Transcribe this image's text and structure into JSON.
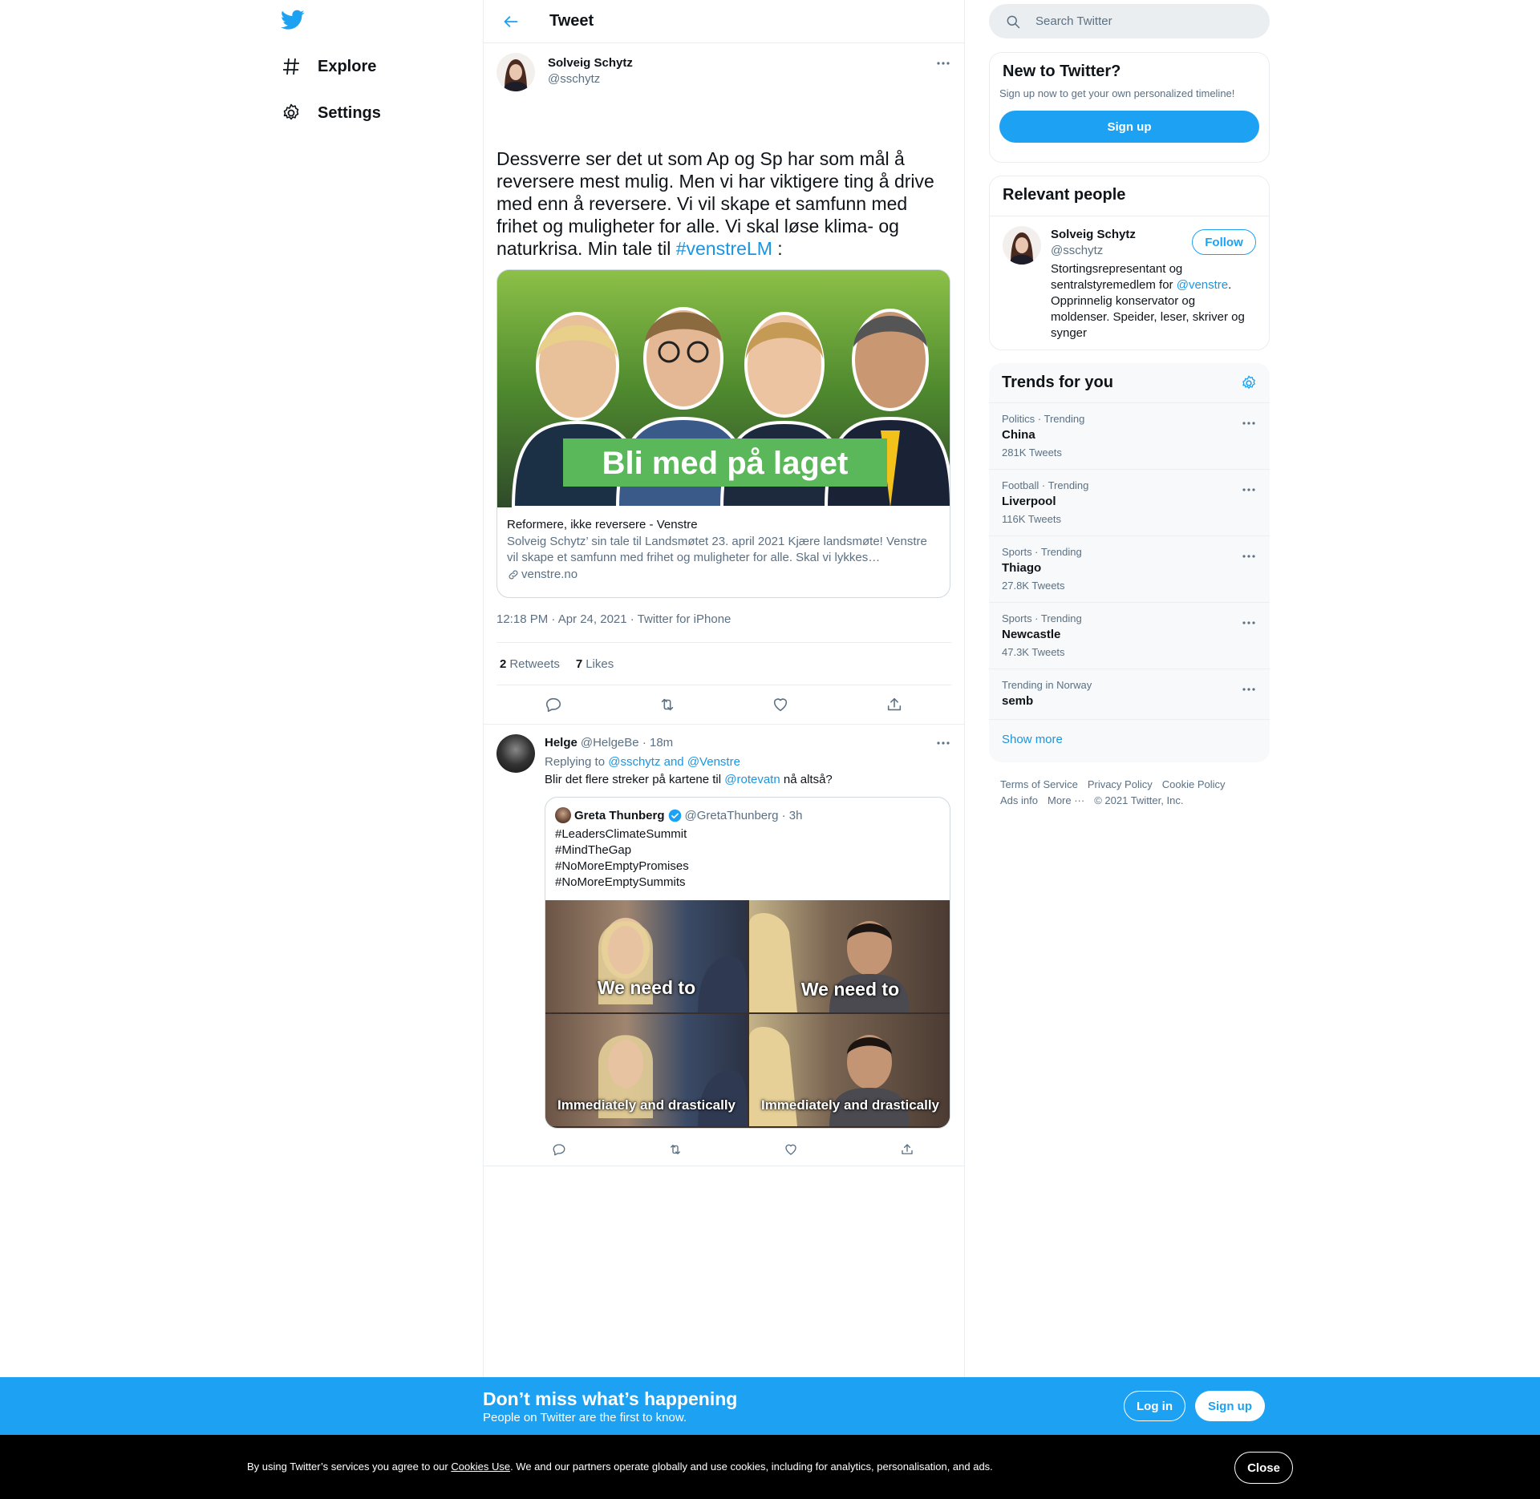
{
  "nav": {
    "logo": "twitter-bird-icon",
    "items": [
      {
        "label": "Explore",
        "icon": "hashtag-icon"
      },
      {
        "label": "Settings",
        "icon": "gear-icon"
      }
    ]
  },
  "header": {
    "title": "Tweet"
  },
  "tweet": {
    "name": "Solveig Schytz",
    "handle": "@sschytz",
    "text_main": "Dessverre ser det ut som Ap og Sp har som mål å reversere mest mulig. Men vi har viktigere ting å drive med enn å reversere. Vi vil skape et samfunn med frihet og muligheter for alle. Vi skal løse klima- og naturkrisa. Min tale til ",
    "hashtag": "#venstreLM",
    "text_end": " :",
    "card": {
      "banner": "Bli med på laget",
      "title": "Reformere, ikke reversere - Venstre",
      "description": "Solveig Schytz’ sin tale til Landsmøtet 23. april 2021 Kjære landsmøte! Venstre vil skape et samfunn med frihet og muligheter for alle. Skal vi lykkes…",
      "domain": "venstre.no"
    },
    "timestamp": "12:18 PM · Apr 24, 2021 · Twitter for iPhone",
    "retweets_count": "2",
    "retweets_label": "Retweets",
    "likes_count": "7",
    "likes_label": "Likes"
  },
  "reply": {
    "name": "Helge",
    "handle": "@HelgeBe",
    "time": "· 18m",
    "replying_prefix": "Replying to ",
    "replying_to": "@sschytz and @Venstre",
    "text_pre": "Blir det flere streker på kartene til ",
    "mention": "@rotevatn",
    "text_post": " nå altså?",
    "quote": {
      "name": "Greta Thunberg",
      "handle": "@GretaThunberg",
      "time": "· 3h",
      "lines": [
        "#LeadersClimateSummit",
        "#MindTheGap",
        "#NoMoreEmptyPromises",
        "#NoMoreEmptySummits"
      ],
      "captions": [
        "We need to",
        "We need to",
        "Immediately and drastically",
        "Immediately and drastically"
      ]
    }
  },
  "search": {
    "placeholder": "Search Twitter"
  },
  "new_to_twitter": {
    "title": "New to Twitter?",
    "subtitle": "Sign up now to get your own personalized timeline!",
    "button": "Sign up"
  },
  "relevant": {
    "title": "Relevant people",
    "name": "Solveig Schytz",
    "handle": "@sschytz",
    "follow": "Follow",
    "bio_pre": "Stortingsrepresentant og sentralstyremedlem for ",
    "bio_mention": "@venstre",
    "bio_post": ". Opprinnelig konservator og moldenser. Speider, leser, skriver og synger"
  },
  "trends": {
    "title": "Trends for you",
    "items": [
      {
        "context": "Politics · Trending",
        "name": "China",
        "count": "281K Tweets"
      },
      {
        "context": "Football · Trending",
        "name": "Liverpool",
        "count": "116K Tweets"
      },
      {
        "context": "Sports · Trending",
        "name": "Thiago",
        "count": "27.8K Tweets"
      },
      {
        "context": "Sports · Trending",
        "name": "Newcastle",
        "count": "47.3K Tweets"
      },
      {
        "context": "Trending in Norway",
        "name": "semb",
        "count": ""
      }
    ],
    "show_more": "Show more"
  },
  "footer": {
    "links": [
      "Terms of Service",
      "Privacy Policy",
      "Cookie Policy",
      "Ads info",
      "More ···",
      "© 2021 Twitter, Inc."
    ]
  },
  "bottom_bar": {
    "title": "Don’t miss what’s happening",
    "subtitle": "People on Twitter are the first to know.",
    "login": "Log in",
    "signup": "Sign up"
  },
  "cookie": {
    "pre": "By using Twitter’s services you agree to our ",
    "link": "Cookies Use",
    "post": ". We and our partners operate globally and use cookies, including for analytics, personalisation, and ads.",
    "close": "Close"
  },
  "colors": {
    "accent": "#1da1f2",
    "link": "#1b95e0",
    "secondary_text": "#5b7083"
  }
}
